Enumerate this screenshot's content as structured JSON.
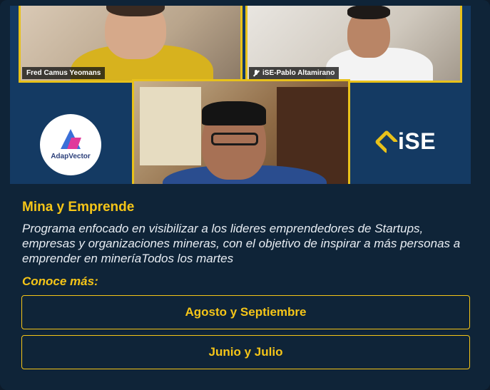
{
  "video": {
    "participants": [
      {
        "name": "Fred Camus Yeomans",
        "muted": false
      },
      {
        "name": "iSE-Pablo Altamirano",
        "muted": true
      }
    ],
    "logos": {
      "left": "AdapVector",
      "right": "iSE"
    },
    "icons": [
      "mic-muted-icon"
    ],
    "accent_color": "#e8c11a"
  },
  "program": {
    "title": "Mina y Emprende",
    "description": "Programa enfocado en visibilizar a los lideres emprendedores de Startups, empresas y organizaciones mineras, con el objetivo de inspirar a más personas a emprender en mineríaTodos los martes",
    "more_label": "Conoce más:",
    "links": [
      {
        "label": "Agosto y Septiembre"
      },
      {
        "label": "Junio y Julio"
      }
    ]
  },
  "colors": {
    "background": "#0f2438",
    "accent": "#f5c518",
    "text": "#e8edf3"
  }
}
